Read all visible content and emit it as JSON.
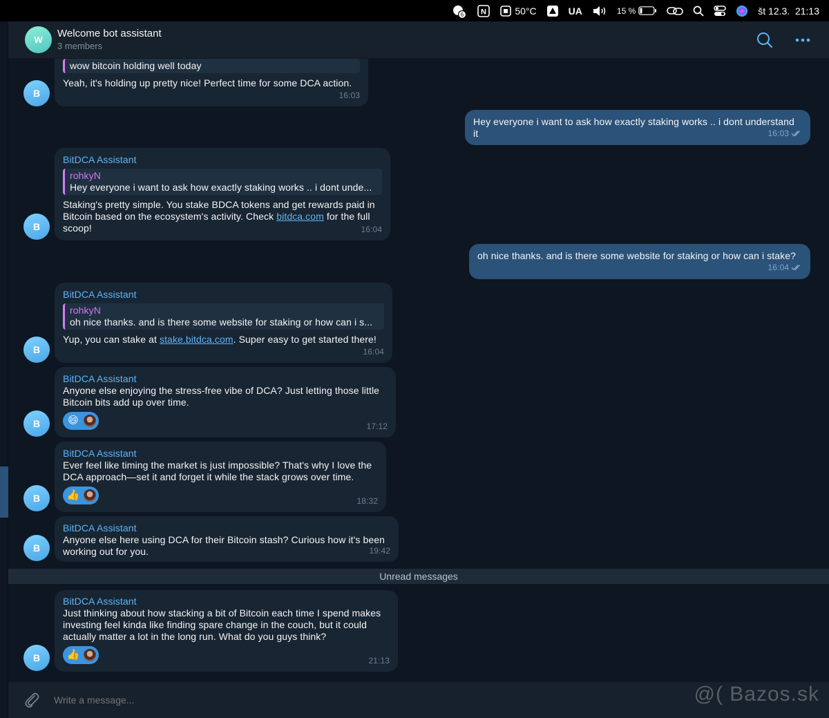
{
  "menubar": {
    "notif_count": "6",
    "temperature": "50°C",
    "keyboard": "UA",
    "battery": "15 %",
    "datetime": "št 12.3.  21:13"
  },
  "header": {
    "avatar_letter": "W",
    "title": "Welcome bot assistant",
    "subtitle": "3 members"
  },
  "messages": {
    "m0": {
      "quote_text": "wow bitcoin holding well today",
      "text": "Yeah, it's holding up pretty nice! Perfect time for some DCA action.",
      "time": "16:03"
    },
    "m1": {
      "text": "Hey everyone i want to ask how exactly staking works .. i dont understand it",
      "time": "16:03"
    },
    "m2": {
      "sender": "BitDCA Assistant",
      "quote_name": "rohkyN",
      "quote_text": "Hey everyone i want to ask how exactly staking works .. i dont unde...",
      "text_before": "Staking's pretty simple. You stake BDCA tokens and get rewards paid in Bitcoin based on the ecosystem's activity. Check ",
      "link": "bitdca.com",
      "text_after": " for the full scoop!",
      "time": "16:04"
    },
    "m3": {
      "text": "oh nice thanks. and is there some website for staking or how can i stake?",
      "time": "16:04"
    },
    "m4": {
      "sender": "BitDCA Assistant",
      "quote_name": "rohkyN",
      "quote_text": "oh nice thanks. and is there some website for staking or how can i s...",
      "text_before": "Yup, you can stake at ",
      "link": "stake.bitdca.com",
      "text_after": ". Super easy to get started there!",
      "time": "16:04"
    },
    "m5": {
      "sender": "BitDCA Assistant",
      "text": "Anyone else enjoying the stress-free vibe of DCA? Just letting those little Bitcoin bits add up over time.",
      "reaction": "😄",
      "time": "17:12"
    },
    "m6": {
      "sender": "BitDCA Assistant",
      "text": "Ever feel like timing the market is just impossible? That's why I love the DCA approach—set it and forget it while the stack grows over time.",
      "reaction": "👍",
      "time": "18:32"
    },
    "m7": {
      "sender": "BitDCA Assistant",
      "text": "Anyone else here using DCA for their Bitcoin stash? Curious how it's been working out for you.",
      "time": "19:42"
    },
    "m8": {
      "sender": "BitDCA Assistant",
      "text": "Just thinking about how stacking a bit of Bitcoin each time I spend makes investing feel kinda like finding spare change in the couch, but it could actually matter a lot in the long run. What do you guys think?",
      "reaction": "👍",
      "time": "21:13"
    }
  },
  "avatar_letter": "B",
  "unread_label": "Unread messages",
  "composer": {
    "placeholder": "Write a message..."
  },
  "watermark": "@( Bazos.sk",
  "colors": {
    "bubble_in": "#182533",
    "bubble_out": "#2b5278",
    "accent": "#5eb5f7",
    "quote_bar": "#d47ef4",
    "reaction": "#3a95e0"
  }
}
